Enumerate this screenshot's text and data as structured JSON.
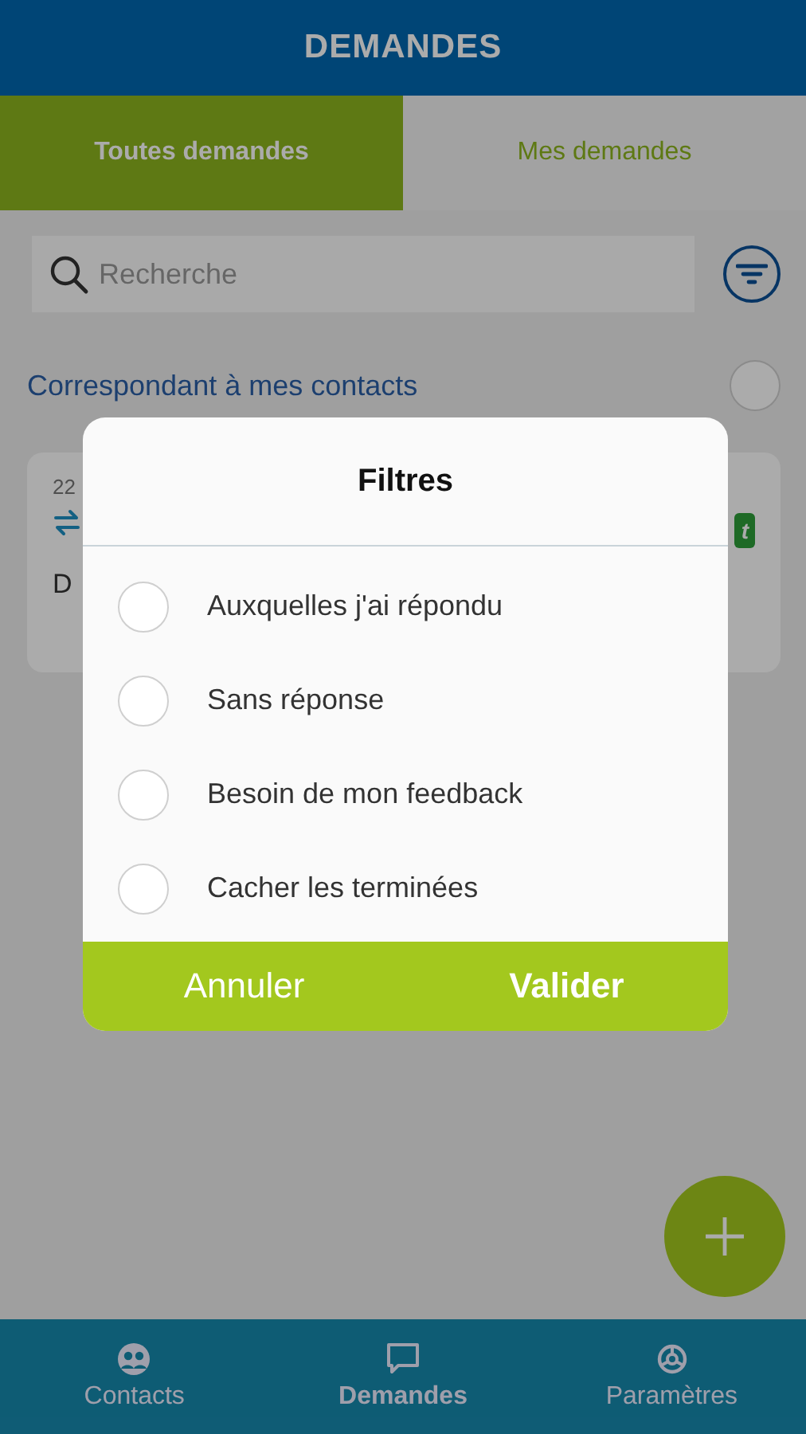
{
  "header": {
    "title": "DEMANDES"
  },
  "tabs": [
    {
      "label": "Toutes demandes",
      "selected": true
    },
    {
      "label": "Mes demandes",
      "selected": false
    }
  ],
  "search": {
    "placeholder": "Recherche"
  },
  "contacts_toggle": {
    "label": "Correspondant à mes contacts",
    "checked": false
  },
  "card": {
    "date": "22",
    "line": "D",
    "badge": "t"
  },
  "modal": {
    "title": "Filtres",
    "options": [
      {
        "label": "Auxquelles j'ai répondu",
        "checked": false
      },
      {
        "label": "Sans réponse",
        "checked": false
      },
      {
        "label": "Besoin de mon feedback",
        "checked": false
      },
      {
        "label": "Cacher les terminées",
        "checked": false
      }
    ],
    "buttons": [
      {
        "label": "Annuler",
        "primary": false
      },
      {
        "label": "Valider",
        "primary": true
      }
    ]
  },
  "bottom_nav": [
    {
      "label": "Contacts",
      "selected": false
    },
    {
      "label": "Demandes",
      "selected": true
    },
    {
      "label": "Paramètres",
      "selected": false
    }
  ]
}
